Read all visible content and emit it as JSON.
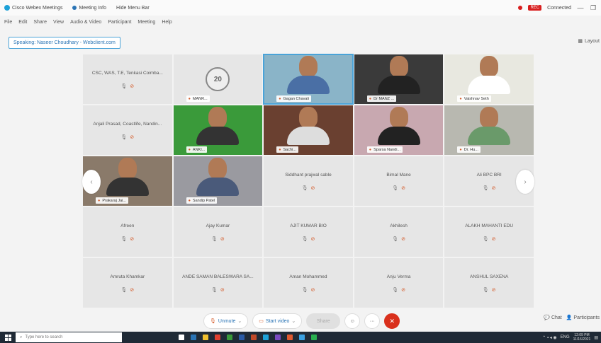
{
  "titlebar": {
    "app_title": "Cisco Webex Meetings",
    "meeting_info": "Meeting Info",
    "hide_menu": "Hide Menu Bar",
    "recording_badge": "REC",
    "connect_label": "Connected",
    "minimize": "—",
    "restore": "❐"
  },
  "menubar": [
    "File",
    "Edit",
    "Share",
    "View",
    "Audio & Video",
    "Participant",
    "Meeting",
    "Help"
  ],
  "speaking": "Speaking: Naseer Choudhary - Webclient.com",
  "layout_label": "Layout",
  "tiles": [
    {
      "name": "CSC, WAS, T.E, Tenkasi Coimba...",
      "type": "blank"
    },
    {
      "name": "",
      "label": "MANR...",
      "type": "logo",
      "logo_text": "20"
    },
    {
      "name": "",
      "label": "Gagan Chavali",
      "type": "video",
      "active": true,
      "bg": "#8ab4c8",
      "shirt": "#4a6fa5"
    },
    {
      "name": "",
      "label": "Dr MANZ ...",
      "type": "video",
      "bg": "#3a3a3a",
      "shirt": "#222"
    },
    {
      "name": "",
      "label": "Vaishnav Seth",
      "type": "video",
      "bg": "#e8e8e0",
      "shirt": "#ffffff"
    },
    {
      "name": "Anjali Prasad, Coastlife, Nandin...",
      "type": "blank"
    },
    {
      "name": "",
      "label": "ANKI...",
      "type": "video",
      "bg": "#3a9a3a",
      "shirt": "#333"
    },
    {
      "name": "",
      "label": "Sachi...",
      "type": "video",
      "bg": "#6a4030",
      "shirt": "#ddd"
    },
    {
      "name": "",
      "label": "Sparsa Nandi...",
      "type": "video",
      "bg": "#c8a8b0",
      "shirt": "#222"
    },
    {
      "name": "",
      "label": "Dr. Hu...",
      "type": "video",
      "bg": "#b8b8b0",
      "shirt": "#6a9a6a"
    },
    {
      "name": "",
      "label": "Prakaraj Jai...",
      "type": "video",
      "bg": "#8a7a6a",
      "shirt": "#333"
    },
    {
      "name": "",
      "label": "Sandip Patel",
      "type": "video",
      "bg": "#9a9aa0",
      "shirt": "#4a5a7a"
    },
    {
      "name": "Siddhant prajwal sable",
      "type": "blank"
    },
    {
      "name": "Bimal Mane",
      "type": "blank"
    },
    {
      "name": "Ali BPC BRI",
      "type": "blank"
    },
    {
      "name": "Afreen",
      "type": "blank"
    },
    {
      "name": "Ajay Kumar",
      "type": "blank"
    },
    {
      "name": "AJIT KUMAR BIO",
      "type": "blank"
    },
    {
      "name": "Akhilesh",
      "type": "blank"
    },
    {
      "name": "ALAKH MAHANTI EDU",
      "type": "blank"
    },
    {
      "name": "Amruta Khamkar",
      "type": "blank"
    },
    {
      "name": "ANDE SAMAN BALESWARA SA...",
      "type": "blank"
    },
    {
      "name": "Aman Mohammed",
      "type": "blank"
    },
    {
      "name": "Anju Verma",
      "type": "blank"
    },
    {
      "name": "ANSHUL SAXENA",
      "type": "blank"
    }
  ],
  "controls": {
    "unmute": "Unmute",
    "start_video": "Start video",
    "share": "Share",
    "chat": "Chat",
    "participants": "Participants"
  },
  "taskbar": {
    "search_placeholder": "Type here to search",
    "time": "12:09 PM",
    "date": "11/16/2021",
    "lang": "ENG"
  },
  "colors": {
    "accent": "#4aa3d8",
    "end_call": "#d9301c",
    "taskbar": "#1f2a36"
  }
}
